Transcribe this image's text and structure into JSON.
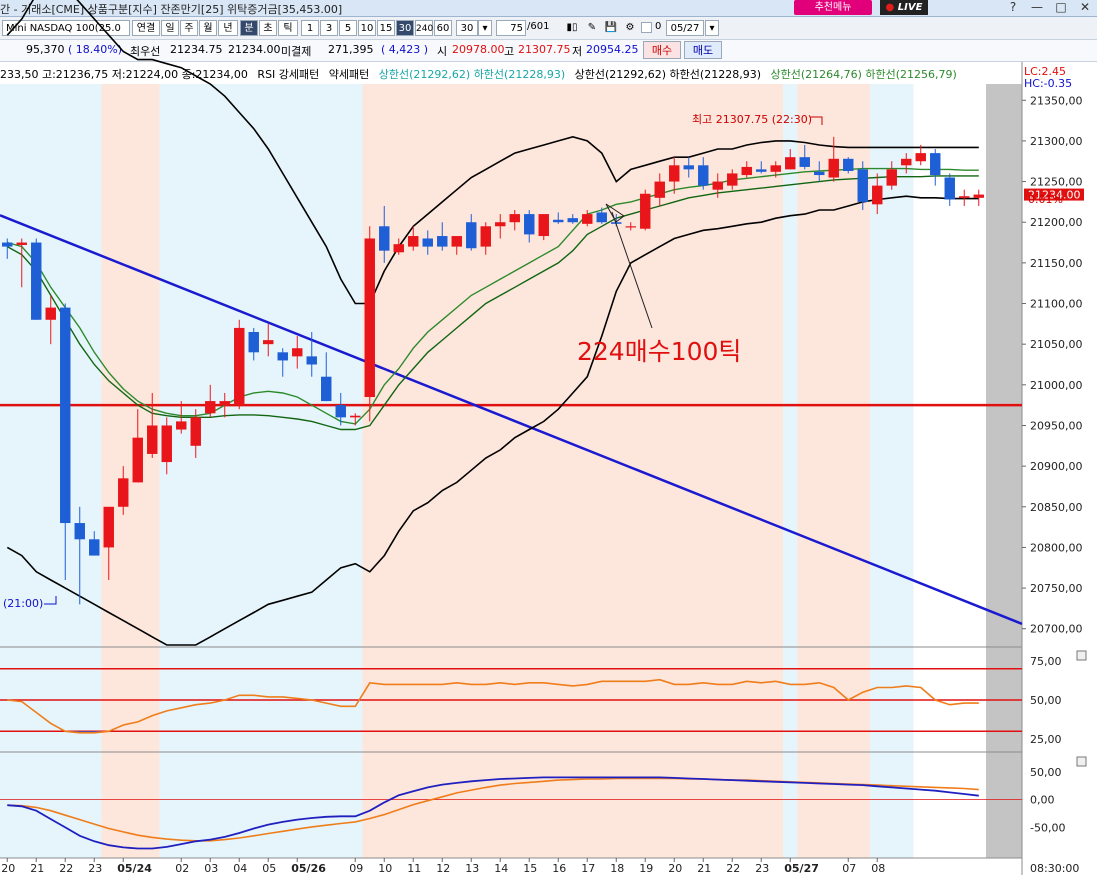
{
  "window": {
    "title": "간 - 거래소[CME] 상품구분[지수] 잔존만기[25] 위탁증거금[35,453.00]",
    "recommend_label": "추천메뉴",
    "live_label": "LIVE",
    "controls": [
      "?",
      "—",
      "□",
      "✕"
    ]
  },
  "toolbar": {
    "symbol": "Mini NASDAQ 100(25.0",
    "buttons": [
      "연결",
      "일",
      "주",
      "월",
      "년",
      "분",
      "초",
      "틱"
    ],
    "active_button": "분",
    "intervals": [
      "1",
      "3",
      "5",
      "10",
      "15",
      "30",
      "240",
      "60"
    ],
    "active_interval": "30",
    "interval_value": "30",
    "count_value": "75",
    "count_total": "/601",
    "date_value": "05/27",
    "checkbox_value": "0"
  },
  "quote": {
    "change": "95,370",
    "change_pct": "( 18.40%)",
    "best_label": "최우선",
    "bid": "21234.75",
    "ask": "21234.00",
    "open_interest_label": "미결제",
    "open_interest": "271,395",
    "oi_change": "( 4,423 )",
    "open_label": "시",
    "open": "20978.00",
    "high_label": "고",
    "high": "21307.75",
    "low_label": "저",
    "low": "20954.25",
    "buy_button": "매수",
    "sell_button": "매도"
  },
  "legend": {
    "ohlc": "233,50 고:21236,75 저:21224,00 종:21234,00",
    "rsi_pattern": "RSI 강세패턴",
    "weak_pattern": "약세패턴",
    "band1": "상한선(21292,62) 하한선(21228,93)",
    "band2": "상한선(21292,62) 하한선(21228,93)",
    "band3": "상한선(21264,76) 하한선(21256,79)",
    "lc": "LC:2.45",
    "hc": "HC:-0.35"
  },
  "annotations": {
    "high_note": "최고 21307.75 (22:30)",
    "low_note": "(21:00)",
    "buy_note": "224매수100틱",
    "last_price": "21234.00",
    "last_pct": "0.01%"
  },
  "colors": {
    "up": "#e8161b",
    "down": "#1f5fd6",
    "band": "#000000",
    "ma_fast": "#2c8a2c",
    "ma_slow": "#126612",
    "trendline": "#1a1ad0",
    "support": "#e01010",
    "shade_pink": "#fde6dc",
    "shade_blue": "#e5f5fb",
    "rsi": "#ef7d1a",
    "macd": "#2020c0"
  },
  "chart_data": [
    {
      "type": "candlestick",
      "title": "",
      "ylim": [
        20680,
        21370
      ],
      "y_ticks": [
        21350,
        21300,
        21250,
        21200,
        21150,
        21100,
        21050,
        21000,
        20950,
        20900,
        20850,
        20800,
        20750,
        20700
      ],
      "y_tick_labels": [
        "21350,00",
        "21300,00",
        "21250,00",
        "21200,00",
        "21150,00",
        "21100,00",
        "21050,00",
        "21000,00",
        "20950,00",
        "20900,00",
        "20850,00",
        "20800,00",
        "20750,00",
        "20700,00"
      ],
      "x_labels": [
        "20",
        "21",
        "22",
        "23",
        "05/24",
        "02",
        "03",
        "04",
        "05",
        "05/26",
        "09",
        "10",
        "11",
        "12",
        "13",
        "14",
        "15",
        "16",
        "17",
        "18",
        "19",
        "20",
        "21",
        "22",
        "23",
        "05/27",
        "07",
        "08"
      ],
      "x_label_bars": [
        0,
        2,
        4,
        6,
        8,
        12,
        14,
        16,
        18,
        20,
        24,
        26,
        28,
        30,
        32,
        34,
        36,
        38,
        40,
        42,
        44,
        46,
        48,
        50,
        52,
        54,
        58,
        60
      ],
      "time_axis_label": "08:30:00",
      "candles": [
        {
          "o": 21175,
          "h": 21180,
          "l": 21155,
          "c": 21170
        },
        {
          "o": 21172,
          "h": 21180,
          "l": 21120,
          "c": 21175
        },
        {
          "o": 21175,
          "h": 21180,
          "l": 21080,
          "c": 21080
        },
        {
          "o": 21080,
          "h": 21110,
          "l": 21050,
          "c": 21095
        },
        {
          "o": 21095,
          "h": 21100,
          "l": 20760,
          "c": 20830
        },
        {
          "o": 20830,
          "h": 20850,
          "l": 20730,
          "c": 20810
        },
        {
          "o": 20810,
          "h": 20820,
          "l": 20790,
          "c": 20790
        },
        {
          "o": 20800,
          "h": 20840,
          "l": 20760,
          "c": 20850
        },
        {
          "o": 20850,
          "h": 20900,
          "l": 20840,
          "c": 20885
        },
        {
          "o": 20880,
          "h": 20970,
          "l": 20880,
          "c": 20935
        },
        {
          "o": 20915,
          "h": 20990,
          "l": 20910,
          "c": 20950
        },
        {
          "o": 20905,
          "h": 20960,
          "l": 20890,
          "c": 20950
        },
        {
          "o": 20945,
          "h": 20980,
          "l": 20940,
          "c": 20955
        },
        {
          "o": 20925,
          "h": 20970,
          "l": 20910,
          "c": 20960
        },
        {
          "o": 20965,
          "h": 21000,
          "l": 20960,
          "c": 20980
        },
        {
          "o": 20975,
          "h": 20990,
          "l": 20960,
          "c": 20980
        },
        {
          "o": 20975,
          "h": 21080,
          "l": 20970,
          "c": 21070
        },
        {
          "o": 21065,
          "h": 21070,
          "l": 21030,
          "c": 21040
        },
        {
          "o": 21050,
          "h": 21075,
          "l": 21035,
          "c": 21055
        },
        {
          "o": 21040,
          "h": 21045,
          "l": 21010,
          "c": 21030
        },
        {
          "o": 21035,
          "h": 21060,
          "l": 21020,
          "c": 21045
        },
        {
          "o": 21035,
          "h": 21065,
          "l": 21010,
          "c": 21025
        },
        {
          "o": 21010,
          "h": 21040,
          "l": 20980,
          "c": 20980
        },
        {
          "o": 20975,
          "h": 20990,
          "l": 20950,
          "c": 20960
        },
        {
          "o": 20960,
          "h": 20965,
          "l": 20950,
          "c": 20962
        },
        {
          "o": 20985,
          "h": 21195,
          "l": 20955,
          "c": 21180
        },
        {
          "o": 21195,
          "h": 21220,
          "l": 21150,
          "c": 21165
        },
        {
          "o": 21163,
          "h": 21180,
          "l": 21160,
          "c": 21173
        },
        {
          "o": 21170,
          "h": 21195,
          "l": 21165,
          "c": 21183
        },
        {
          "o": 21180,
          "h": 21190,
          "l": 21160,
          "c": 21170
        },
        {
          "o": 21183,
          "h": 21200,
          "l": 21165,
          "c": 21170
        },
        {
          "o": 21170,
          "h": 21180,
          "l": 21160,
          "c": 21183
        },
        {
          "o": 21200,
          "h": 21210,
          "l": 21165,
          "c": 21168
        },
        {
          "o": 21170,
          "h": 21200,
          "l": 21160,
          "c": 21195
        },
        {
          "o": 21195,
          "h": 21210,
          "l": 21180,
          "c": 21200
        },
        {
          "o": 21200,
          "h": 21215,
          "l": 21190,
          "c": 21210
        },
        {
          "o": 21210,
          "h": 21215,
          "l": 21175,
          "c": 21185
        },
        {
          "o": 21183,
          "h": 21210,
          "l": 21178,
          "c": 21210
        },
        {
          "o": 21203,
          "h": 21212,
          "l": 21198,
          "c": 21200
        },
        {
          "o": 21205,
          "h": 21210,
          "l": 21198,
          "c": 21200
        },
        {
          "o": 21198,
          "h": 21215,
          "l": 21195,
          "c": 21210
        },
        {
          "o": 21212,
          "h": 21218,
          "l": 21198,
          "c": 21200
        },
        {
          "o": 21200,
          "h": 21210,
          "l": 21195,
          "c": 21198
        },
        {
          "o": 21195,
          "h": 21200,
          "l": 21190,
          "c": 21195
        },
        {
          "o": 21192,
          "h": 21240,
          "l": 21190,
          "c": 21235
        },
        {
          "o": 21230,
          "h": 21260,
          "l": 21220,
          "c": 21250
        },
        {
          "o": 21250,
          "h": 21280,
          "l": 21235,
          "c": 21270
        },
        {
          "o": 21270,
          "h": 21280,
          "l": 21255,
          "c": 21265
        },
        {
          "o": 21270,
          "h": 21280,
          "l": 21240,
          "c": 21245
        },
        {
          "o": 21240,
          "h": 21260,
          "l": 21230,
          "c": 21250
        },
        {
          "o": 21245,
          "h": 21265,
          "l": 21240,
          "c": 21260
        },
        {
          "o": 21258,
          "h": 21275,
          "l": 21255,
          "c": 21268
        },
        {
          "o": 21265,
          "h": 21275,
          "l": 21260,
          "c": 21262
        },
        {
          "o": 21262,
          "h": 21275,
          "l": 21255,
          "c": 21270
        },
        {
          "o": 21265,
          "h": 21290,
          "l": 21265,
          "c": 21280
        },
        {
          "o": 21280,
          "h": 21295,
          "l": 21265,
          "c": 21268
        },
        {
          "o": 21262,
          "h": 21275,
          "l": 21250,
          "c": 21258
        },
        {
          "o": 21255,
          "h": 21305,
          "l": 21250,
          "c": 21278
        },
        {
          "o": 21278,
          "h": 21280,
          "l": 21260,
          "c": 21263
        },
        {
          "o": 21265,
          "h": 21275,
          "l": 21215,
          "c": 21225
        },
        {
          "o": 21222,
          "h": 21260,
          "l": 21210,
          "c": 21245
        },
        {
          "o": 21245,
          "h": 21275,
          "l": 21240,
          "c": 21265
        },
        {
          "o": 21270,
          "h": 21285,
          "l": 21260,
          "c": 21278
        },
        {
          "o": 21275,
          "h": 21295,
          "l": 21270,
          "c": 21285
        },
        {
          "o": 21285,
          "h": 21290,
          "l": 21245,
          "c": 21258
        },
        {
          "o": 21255,
          "h": 21260,
          "l": 21220,
          "c": 21228
        },
        {
          "o": 21230,
          "h": 21240,
          "l": 21220,
          "c": 21232
        },
        {
          "o": 21230,
          "h": 21240,
          "l": 21220,
          "c": 21234
        }
      ],
      "bollinger_upper": [
        21430,
        21450,
        21480,
        21500,
        21490,
        21470,
        21450,
        21430,
        21410,
        21400,
        21400,
        21395,
        21390,
        21380,
        21370,
        21355,
        21335,
        21315,
        21290,
        21260,
        21230,
        21200,
        21170,
        21130,
        21100,
        21100,
        21140,
        21170,
        21195,
        21210,
        21225,
        21240,
        21255,
        21265,
        21275,
        21285,
        21290,
        21295,
        21300,
        21305,
        21300,
        21285,
        21250,
        21265,
        21270,
        21275,
        21280,
        21280,
        21285,
        21290,
        21290,
        21295,
        21298,
        21300,
        21300,
        21298,
        21295,
        21293,
        21292,
        21292,
        21292,
        21292,
        21292,
        21292,
        21292,
        21292,
        21292,
        21292
      ],
      "bollinger_lower": [
        20800,
        20790,
        20770,
        20760,
        20750,
        20740,
        20730,
        20720,
        20710,
        20700,
        20690,
        20680,
        20680,
        20680,
        20690,
        20700,
        20710,
        20720,
        20730,
        20735,
        20740,
        20745,
        20760,
        20775,
        20780,
        20770,
        20790,
        20820,
        20845,
        20855,
        20870,
        20880,
        20895,
        20910,
        20920,
        20935,
        20945,
        20955,
        20970,
        20990,
        21010,
        21060,
        21115,
        21150,
        21160,
        21170,
        21180,
        21185,
        21190,
        21192,
        21195,
        21198,
        21200,
        21205,
        21208,
        21210,
        21215,
        21215,
        21220,
        21225,
        21228,
        21230,
        21232,
        21230,
        21230,
        21229,
        21229,
        21229
      ],
      "ma_fast": [
        21175,
        21170,
        21150,
        21120,
        21095,
        21070,
        21040,
        21015,
        20995,
        20980,
        20970,
        20965,
        20962,
        20962,
        20965,
        20975,
        20985,
        20990,
        20992,
        20990,
        20985,
        20975,
        20965,
        20955,
        20952,
        20970,
        21000,
        21020,
        21045,
        21065,
        21080,
        21095,
        21110,
        21120,
        21130,
        21140,
        21150,
        21160,
        21170,
        21190,
        21210,
        21215,
        21222,
        21225,
        21230,
        21235,
        21240,
        21243,
        21245,
        21248,
        21252,
        21254,
        21256,
        21258,
        21260,
        21262,
        21263,
        21264,
        21265,
        21266,
        21266,
        21266,
        21266,
        21265,
        21265,
        21265,
        21264,
        21264
      ],
      "ma_slow": [
        21170,
        21160,
        21140,
        21110,
        21080,
        21050,
        21025,
        21005,
        20990,
        20975,
        20965,
        20962,
        20960,
        20960,
        20960,
        20962,
        20963,
        20963,
        20962,
        20960,
        20958,
        20955,
        20950,
        20945,
        20945,
        20950,
        20975,
        21000,
        21020,
        21040,
        21055,
        21070,
        21085,
        21100,
        21110,
        21120,
        21130,
        21140,
        21150,
        21165,
        21185,
        21195,
        21205,
        21210,
        21215,
        21220,
        21225,
        21230,
        21233,
        21236,
        21238,
        21240,
        21242,
        21244,
        21246,
        21248,
        21250,
        21252,
        21253,
        21254,
        21255,
        21256,
        21256,
        21256,
        21257,
        21257,
        21257,
        21257
      ],
      "trendline": {
        "from": {
          "bar": 0,
          "price": 21205
        },
        "to": {
          "bar": 69,
          "price": 20713
        }
      },
      "support_line": 20975,
      "last_price": 21234.0
    },
    {
      "type": "line",
      "title": "",
      "name": "RSI",
      "ylim": [
        18,
        82
      ],
      "y_ticks": [
        75,
        50,
        25
      ],
      "y_tick_labels": [
        "75,00",
        "50,00",
        "25,00"
      ],
      "levels": [
        70,
        50,
        30
      ],
      "values": [
        50,
        49,
        42,
        35,
        30,
        29,
        29,
        30,
        34,
        36,
        40,
        43,
        45,
        47,
        48,
        50,
        53,
        53,
        52,
        52,
        51,
        50,
        48,
        46,
        46,
        61,
        60,
        60,
        60,
        60,
        60,
        61,
        60,
        60,
        61,
        60,
        61,
        61,
        60,
        59,
        60,
        62,
        62,
        62,
        62,
        63,
        60,
        60,
        61,
        60,
        60,
        62,
        61,
        62,
        60,
        60,
        61,
        58,
        50,
        55,
        58,
        58,
        59,
        58,
        50,
        47,
        48,
        48
      ]
    },
    {
      "type": "line",
      "title": "",
      "name": "MACD",
      "ylim": [
        -105,
        82
      ],
      "y_ticks": [
        50,
        0,
        -50
      ],
      "y_tick_labels": [
        "50,00",
        "0,00",
        "-50,00"
      ],
      "zero_line": 0,
      "macd": [
        -10,
        -12,
        -20,
        -35,
        -50,
        -65,
        -75,
        -82,
        -86,
        -88,
        -88,
        -85,
        -80,
        -75,
        -72,
        -67,
        -60,
        -52,
        -45,
        -40,
        -36,
        -33,
        -31,
        -30,
        -30,
        -20,
        -5,
        8,
        15,
        22,
        27,
        30,
        33,
        35,
        37,
        38,
        39,
        40,
        40,
        40,
        40,
        40,
        40,
        40,
        40,
        40,
        39,
        38,
        37,
        36,
        35,
        34,
        33,
        32,
        31,
        30,
        29,
        28,
        27,
        26,
        24,
        22,
        20,
        18,
        16,
        13,
        10,
        7
      ],
      "signal": [
        -10,
        -11,
        -14,
        -20,
        -28,
        -36,
        -44,
        -52,
        -58,
        -64,
        -68,
        -71,
        -73,
        -74,
        -74,
        -72,
        -69,
        -65,
        -61,
        -57,
        -53,
        -49,
        -46,
        -43,
        -40,
        -34,
        -27,
        -18,
        -9,
        -2,
        5,
        12,
        17,
        22,
        26,
        29,
        31,
        33,
        35,
        36,
        37,
        37,
        38,
        38,
        38,
        38,
        38,
        37,
        37,
        36,
        35,
        35,
        34,
        33,
        32,
        31,
        30,
        29,
        28,
        27,
        26,
        25,
        24,
        23,
        22,
        21,
        20,
        18
      ]
    }
  ]
}
